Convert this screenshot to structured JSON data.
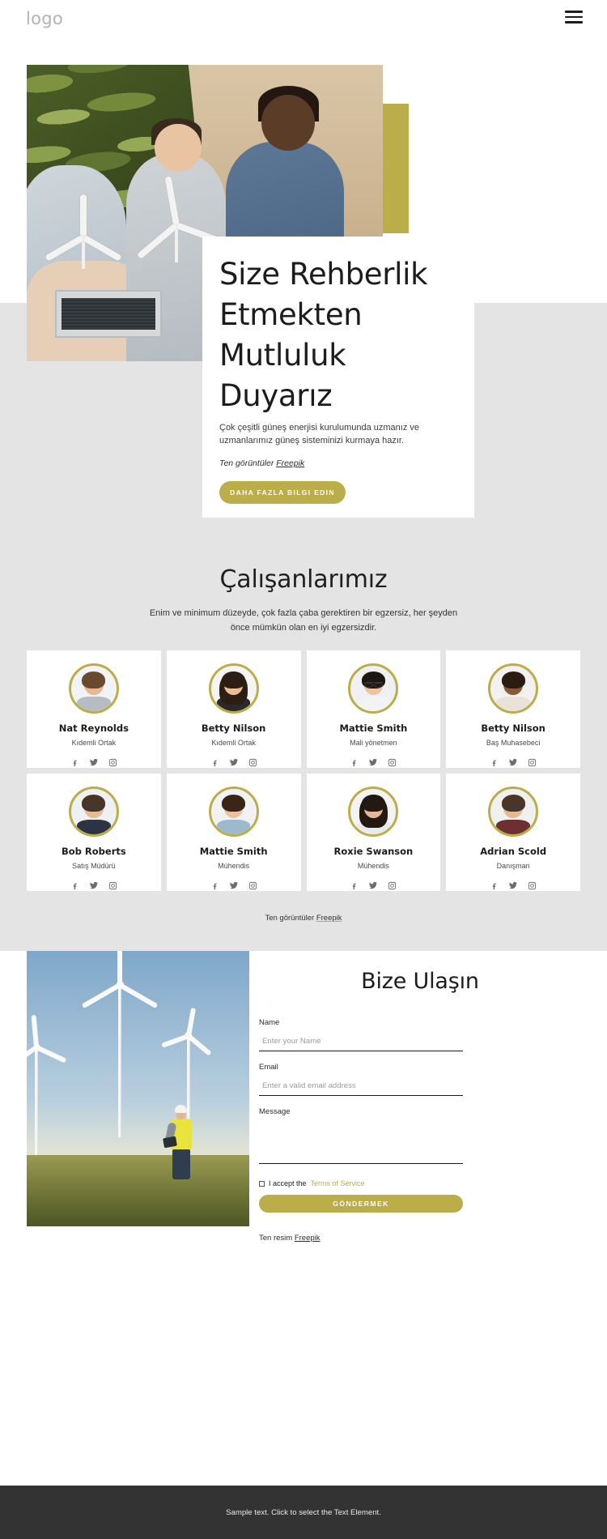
{
  "header": {
    "logo": "logo",
    "menu_icon": "hamburger-menu-icon"
  },
  "hero": {
    "title": "Size Rehberlik Etmekten Mutluluk Duyarız",
    "description": "Çok çeşitli güneş enerjisi kurulumunda uzmanız ve uzmanlarımız güneş sisteminizi kurmaya hazır.",
    "credit_prefix": "Ten görüntüler ",
    "credit_link": "Freepik",
    "button_label": "DAHA FAZLA BILGI EDIN"
  },
  "team": {
    "title": "Çalışanlarımız",
    "subtitle": "Enim ve minimum düzeyde, çok fazla çaba gerektiren bir egzersiz, her şeyden önce mümkün olan en iyi egzersizdir.",
    "credit_prefix": "Ten görüntüler ",
    "credit_link": "Freepik",
    "social": [
      "facebook-icon",
      "twitter-icon",
      "instagram-icon"
    ],
    "members": [
      {
        "name": "Nat Reynolds",
        "role": "Kıdemli Ortak"
      },
      {
        "name": "Betty Nilson",
        "role": "Kıdemli Ortak"
      },
      {
        "name": "Mattie Smith",
        "role": "Mali yönetmen"
      },
      {
        "name": "Betty Nilson",
        "role": "Baş Muhasebeci"
      },
      {
        "name": "Bob Roberts",
        "role": "Satış Müdürü"
      },
      {
        "name": "Mattie Smith",
        "role": "Mühendis"
      },
      {
        "name": "Roxie Swanson",
        "role": "Mühendis"
      },
      {
        "name": "Adrian Scold",
        "role": "Danışman"
      }
    ]
  },
  "contact": {
    "title": "Bize Ulaşın",
    "name_label": "Name",
    "name_placeholder": "Enter your Name",
    "name_value": "",
    "email_label": "Email",
    "email_placeholder": "Enter a valid email address",
    "email_value": "",
    "message_label": "Message",
    "message_placeholder": "",
    "message_value": "",
    "accept_text": "I accept the",
    "terms_link": "Terms of Service",
    "submit_label": "GÖNDERMEK",
    "credit_prefix": "Ten resim ",
    "credit_link": "Freepik"
  },
  "footer": {
    "text": "Sample text. Click to select the Text Element."
  },
  "colors": {
    "accent": "#bcad4b",
    "page_bg_grey": "#e4e4e4",
    "footer_bg": "#333333",
    "text_dark": "#1c1c1c"
  }
}
